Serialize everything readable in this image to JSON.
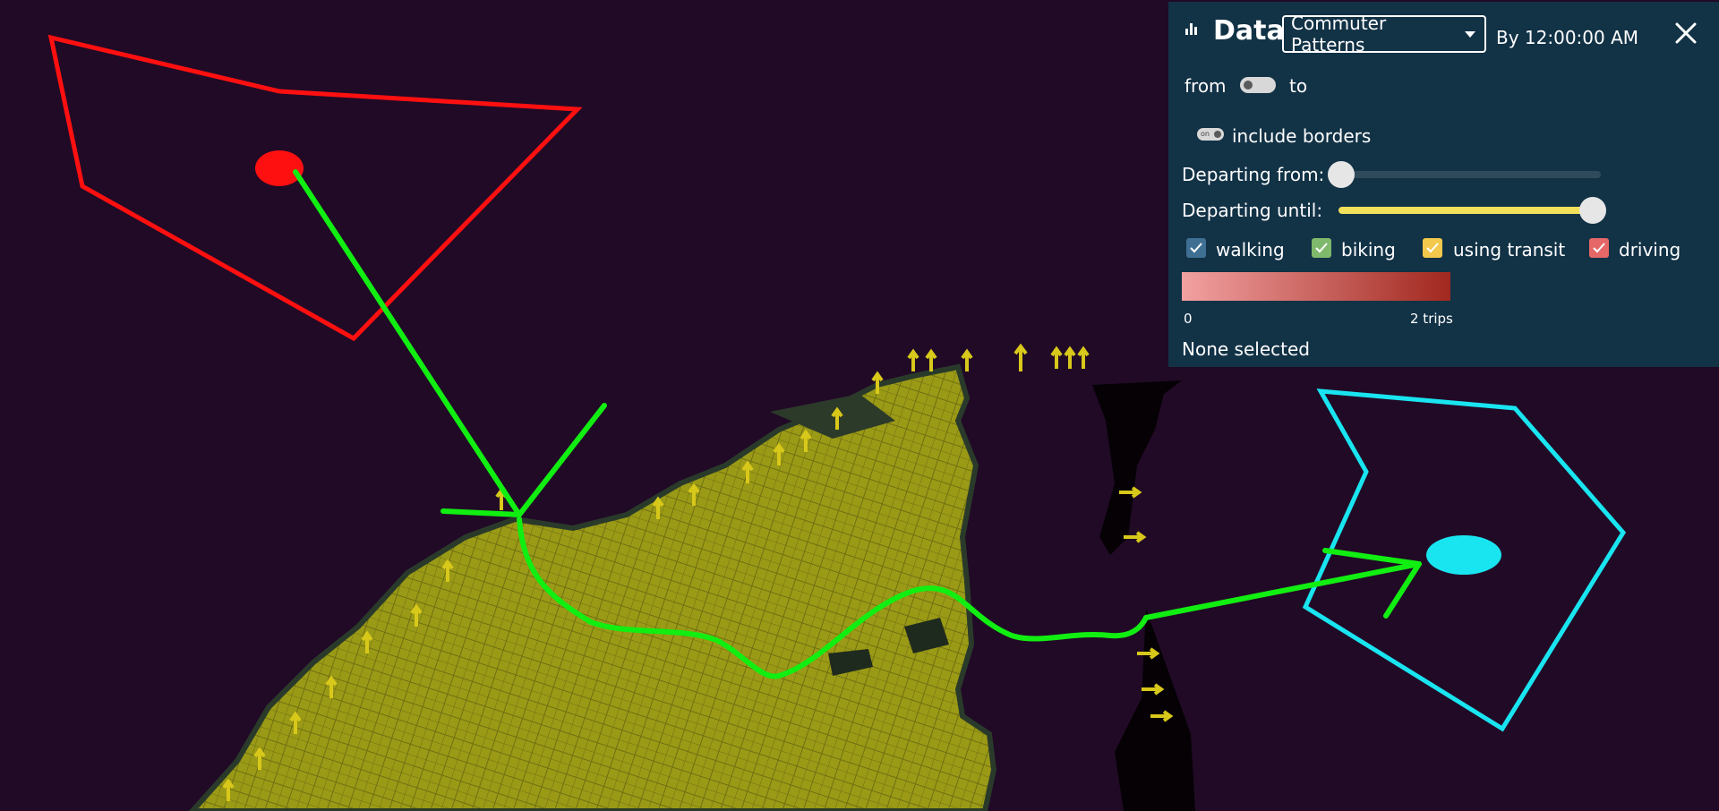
{
  "panel": {
    "title": "Data",
    "dataset": "Commuter Patterns",
    "time_label": "By 12:00:00 AM",
    "direction": {
      "from_label": "from",
      "to_label": "to",
      "state": "from"
    },
    "include_borders": {
      "toggle_text": "on",
      "label": "include borders"
    },
    "departing_from": {
      "label": "Departing from:",
      "value": 0
    },
    "departing_until": {
      "label": "Departing until:",
      "value": 1
    },
    "modes": [
      {
        "label": "walking",
        "checked": true,
        "color": "#3f6f93"
      },
      {
        "label": "biking",
        "checked": true,
        "color": "#7fb96b"
      },
      {
        "label": "using transit",
        "checked": true,
        "color": "#f2c94c"
      },
      {
        "label": "driving",
        "checked": true,
        "color": "#e56767"
      }
    ],
    "legend": {
      "min_label": "0",
      "max_label": "2 trips",
      "color_start": "#f2a1a1",
      "color_end": "#a1281f"
    },
    "status": "None selected"
  },
  "colors": {
    "background": "#210a26",
    "land": "#9c9c14",
    "red_annotation": "#ff1010",
    "cyan_annotation": "#19e5f0",
    "green_route": "#11ee11",
    "panel": "#123246",
    "slider_active": "#f0e05a"
  }
}
